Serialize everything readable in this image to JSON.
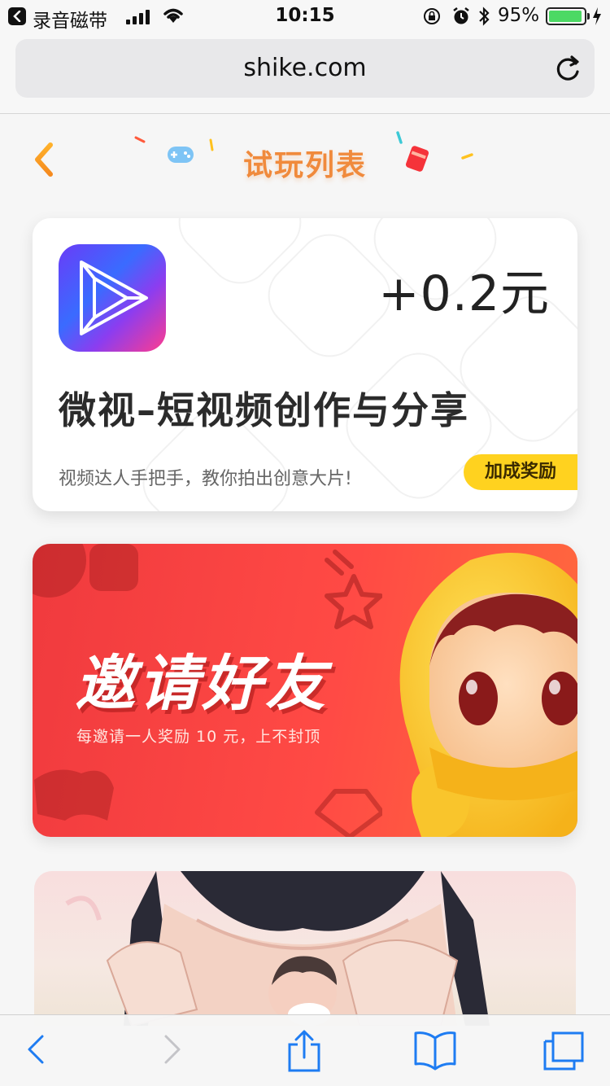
{
  "status_bar": {
    "back_app": "录音磁带",
    "time": "10:15",
    "battery_percent": "95%",
    "battery_level": 0.95,
    "icons": [
      "signal-icon",
      "wifi-icon",
      "orientation-lock-icon",
      "alarm-icon",
      "bluetooth-icon",
      "battery-icon",
      "charging-icon"
    ]
  },
  "browser": {
    "url": "shike.com",
    "icons": [
      "reload-icon"
    ]
  },
  "header": {
    "title": "试玩列表",
    "icons": [
      "back-chevron-icon",
      "gamepad-icon",
      "red-packet-icon"
    ]
  },
  "task_card": {
    "reward": "+0.2元",
    "app_name": "微视–短视频创作与分享",
    "description": "视频达人手把手，教你拍出创意大片!",
    "badge": "加成奖励",
    "icon": "weishi-play-icon"
  },
  "invite_banner": {
    "title": "邀请好友",
    "subtitle": "每邀请一人奖励 10 元，上不封顶"
  },
  "toolbar": {
    "icons": [
      "back-icon",
      "forward-icon",
      "share-icon",
      "bookmarks-icon",
      "tabs-icon"
    ]
  },
  "colors": {
    "title_orange": "#f08a3c",
    "badge_yellow": "#ffd21f",
    "banner_red": "#f03a3e",
    "ios_blue": "#1e7cf2"
  }
}
